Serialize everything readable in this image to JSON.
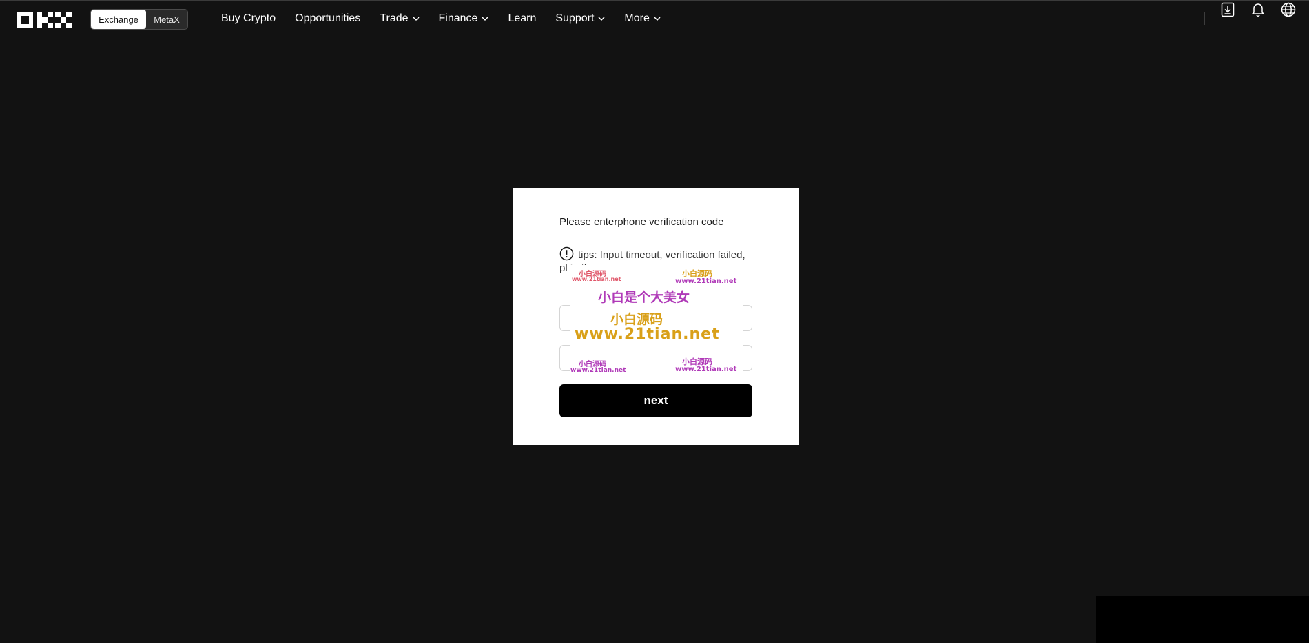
{
  "nav": {
    "logo": "OKX",
    "toggle": {
      "active": "Exchange",
      "inactive": "MetaX"
    },
    "items": [
      {
        "label": "Buy Crypto",
        "has_chevron": false
      },
      {
        "label": "Opportunities",
        "has_chevron": false
      },
      {
        "label": "Trade",
        "has_chevron": true
      },
      {
        "label": "Finance",
        "has_chevron": true
      },
      {
        "label": "Learn",
        "has_chevron": false
      },
      {
        "label": "Support",
        "has_chevron": true
      },
      {
        "label": "More",
        "has_chevron": true
      }
    ],
    "icons": [
      "download-icon",
      "bell-icon",
      "globe-icon"
    ]
  },
  "card": {
    "title": "Please enterphone verification code",
    "tips": "tips: Input timeout, verification failed, pl in th",
    "tips_icon": "alert-circle-icon",
    "field1_placeholder": "",
    "field2_placeholder": "",
    "next_label": "next"
  },
  "watermark": {
    "line_main": "小白是个大美女",
    "line_brand": "小白源码",
    "line_url": "www.21tian.net",
    "small_brand": "小白源码",
    "small_url": "www.21tian.net"
  },
  "colors": {
    "background": "#121212",
    "card": "#ffffff",
    "button": "#000000",
    "watermark_purple": "#b03ab8",
    "watermark_gold": "#d9a019",
    "watermark_pink": "#e0576a"
  }
}
